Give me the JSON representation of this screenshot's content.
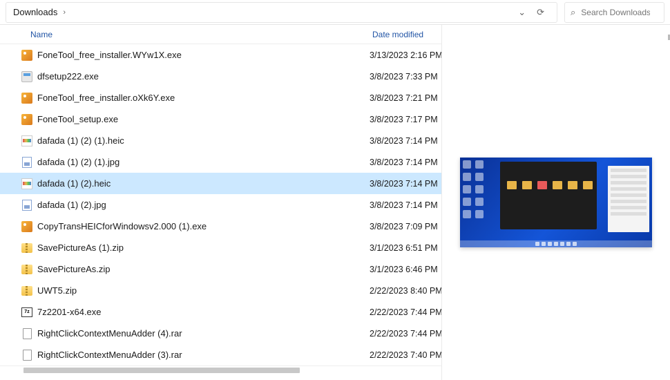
{
  "header": {
    "breadcrumb": "Downloads",
    "search_placeholder": "Search Downloads"
  },
  "columns": {
    "name": "Name",
    "date": "Date modified"
  },
  "selected_index": 6,
  "files": [
    {
      "icon": "installer",
      "name": "FoneTool_free_installer.WYw1X.exe",
      "date": "3/13/2023 2:16 PM"
    },
    {
      "icon": "exe",
      "name": "dfsetup222.exe",
      "date": "3/8/2023 7:33 PM"
    },
    {
      "icon": "installer",
      "name": "FoneTool_free_installer.oXk6Y.exe",
      "date": "3/8/2023 7:21 PM"
    },
    {
      "icon": "installer",
      "name": "FoneTool_setup.exe",
      "date": "3/8/2023 7:17 PM"
    },
    {
      "icon": "heic",
      "name": "dafada  (1) (2) (1).heic",
      "date": "3/8/2023 7:14 PM"
    },
    {
      "icon": "jpg",
      "name": "dafada  (1) (2) (1).jpg",
      "date": "3/8/2023 7:14 PM"
    },
    {
      "icon": "heic",
      "name": "dafada  (1) (2).heic",
      "date": "3/8/2023 7:14 PM"
    },
    {
      "icon": "jpg",
      "name": "dafada  (1) (2).jpg",
      "date": "3/8/2023 7:14 PM"
    },
    {
      "icon": "installer",
      "name": "CopyTransHEICforWindowsv2.000 (1).exe",
      "date": "3/8/2023 7:09 PM"
    },
    {
      "icon": "zip",
      "name": "SavePictureAs (1).zip",
      "date": "3/1/2023 6:51 PM"
    },
    {
      "icon": "zip",
      "name": "SavePictureAs.zip",
      "date": "3/1/2023 6:46 PM"
    },
    {
      "icon": "zip",
      "name": "UWT5.zip",
      "date": "2/22/2023 8:40 PM"
    },
    {
      "icon": "sevenz",
      "name": "7z2201-x64.exe",
      "date": "2/22/2023 7:44 PM"
    },
    {
      "icon": "file",
      "name": "RightClickContextMenuAdder (4).rar",
      "date": "2/22/2023 7:44 PM"
    },
    {
      "icon": "file",
      "name": "RightClickContextMenuAdder (3).rar",
      "date": "2/22/2023 7:40 PM"
    }
  ]
}
